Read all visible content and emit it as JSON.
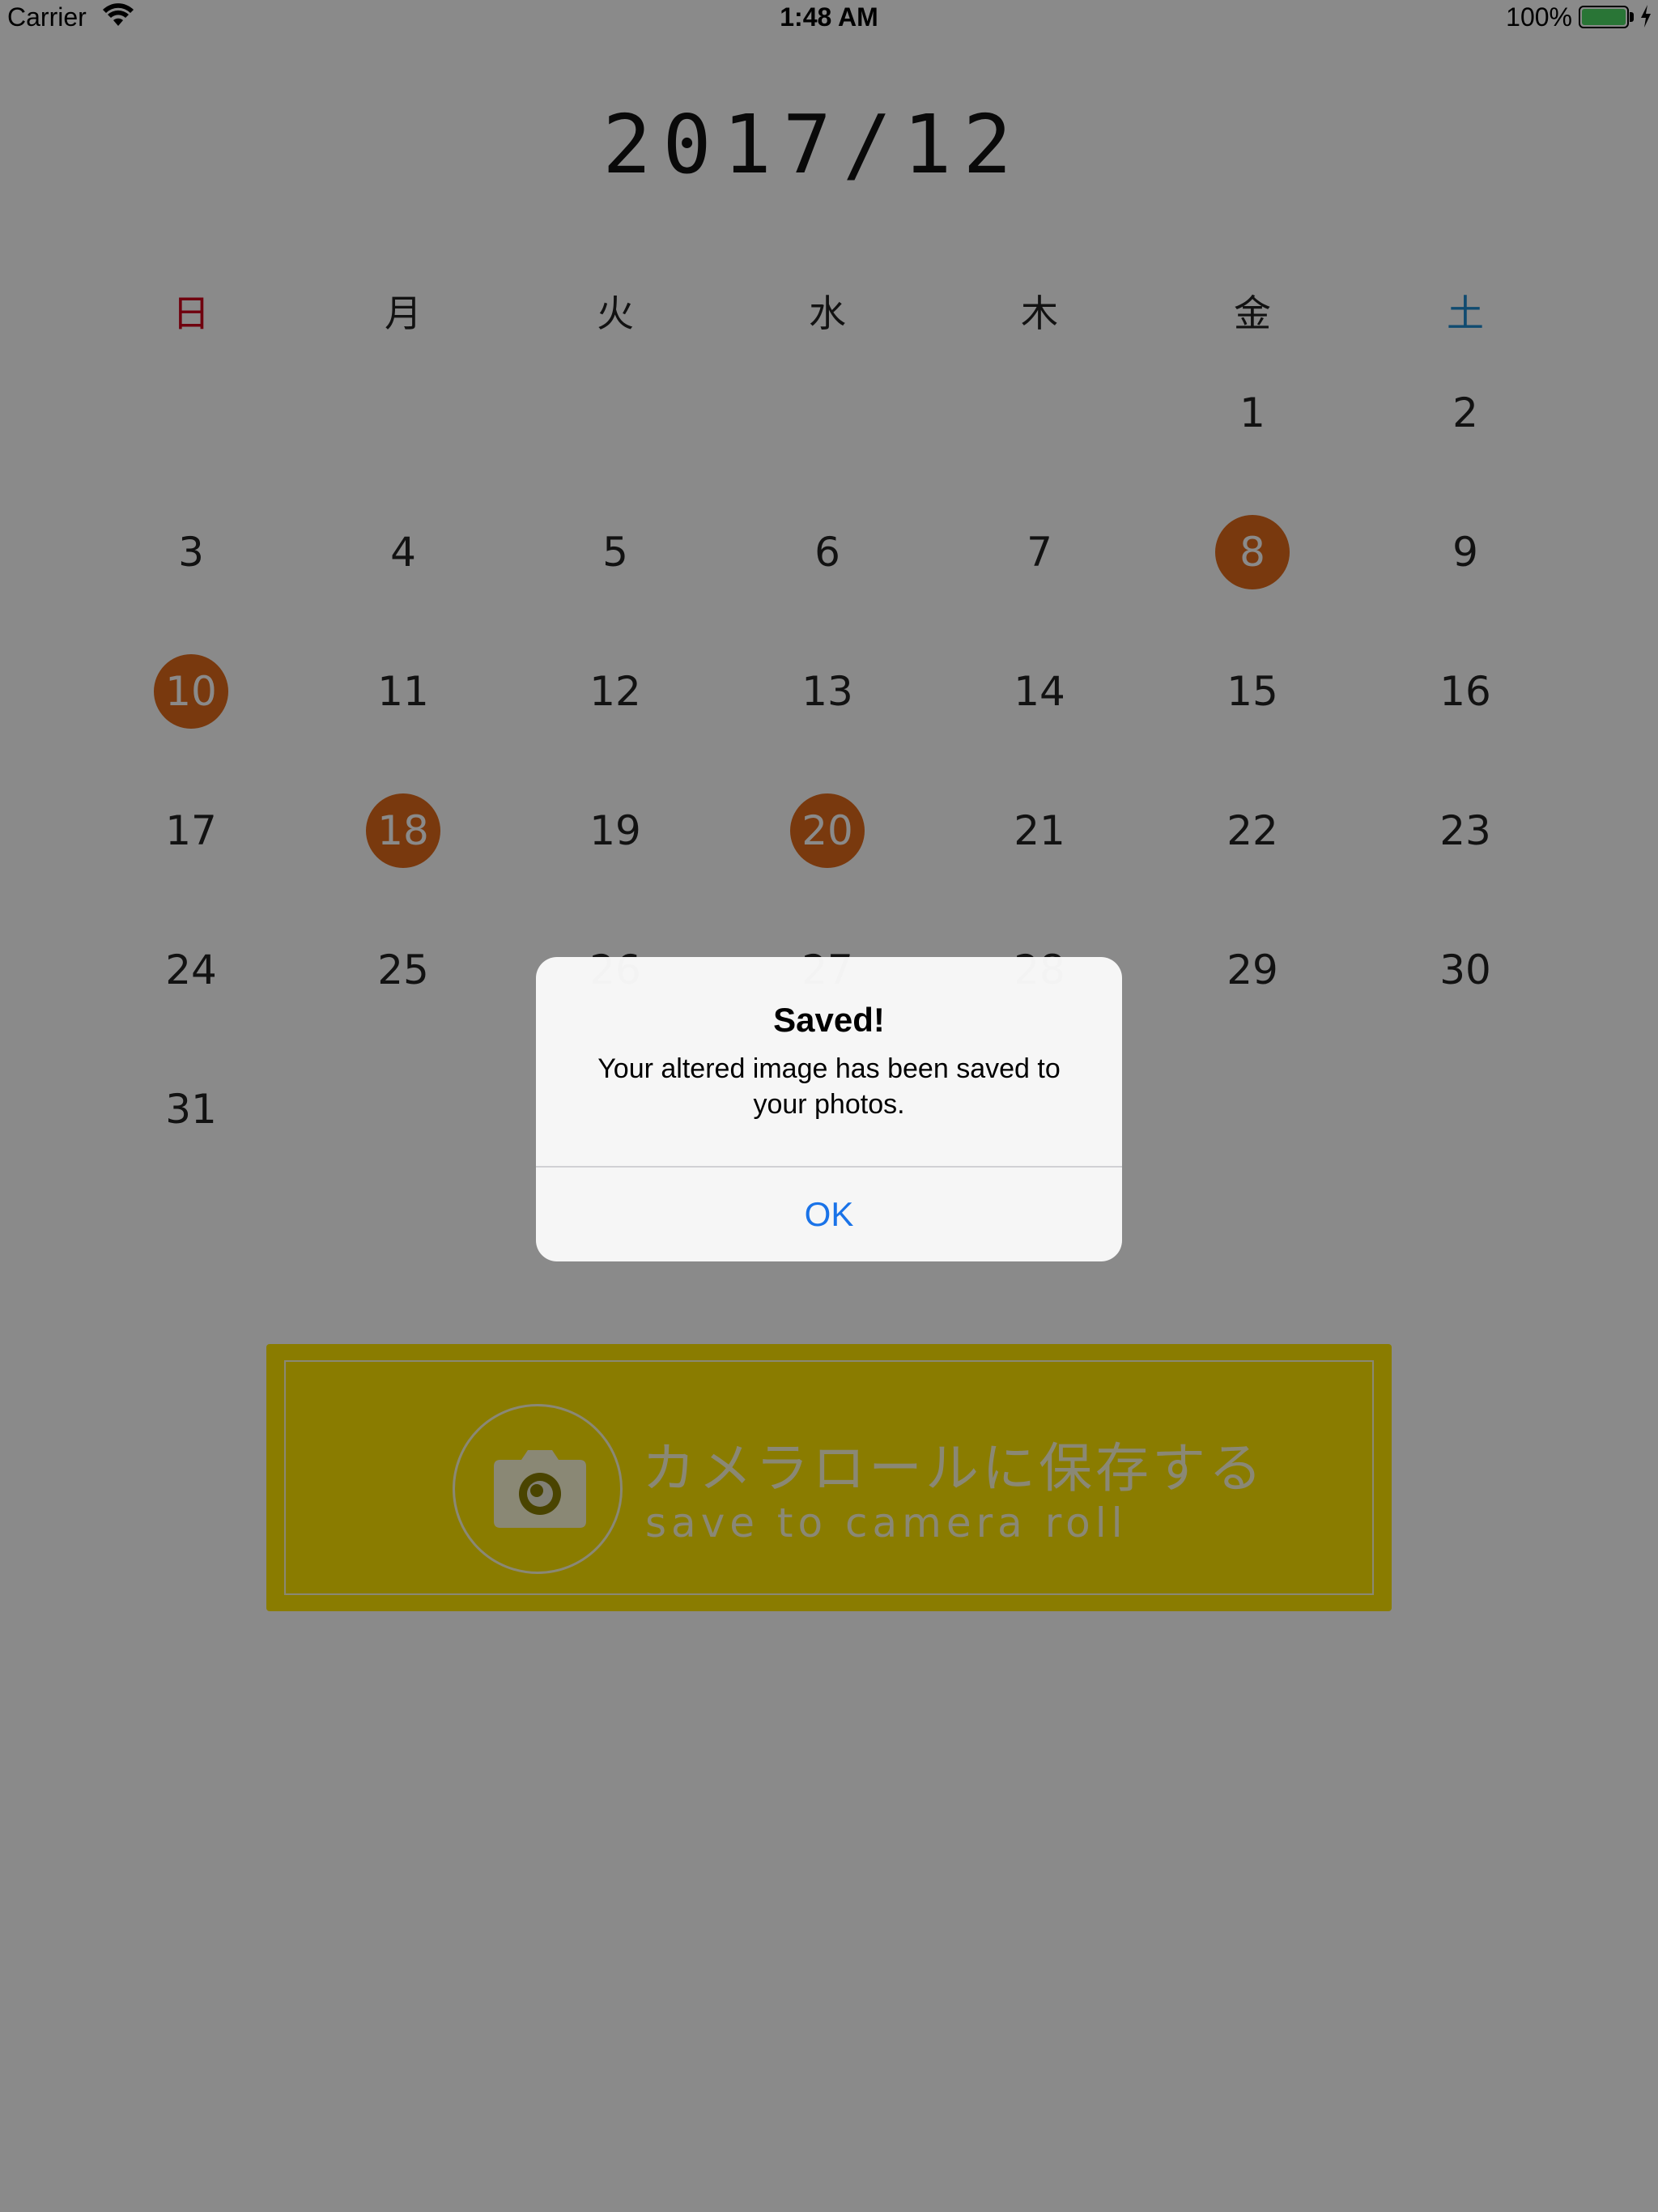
{
  "status_bar": {
    "carrier": "Carrier",
    "time": "1:48 AM",
    "battery_percent": "100%",
    "battery_level": 1.0,
    "battery_color": "#4cd964",
    "wifi_icon": "wifi-icon",
    "charging_icon": "bolt-icon"
  },
  "calendar": {
    "month_title": "2017/12",
    "weekdays": [
      "日",
      "月",
      "火",
      "水",
      "木",
      "金",
      "土"
    ],
    "weekday_colors": {
      "sunday": "#d0021b",
      "saturday": "#1e8bd0",
      "default": "#222222"
    },
    "days": [
      "1",
      "2",
      "3",
      "4",
      "5",
      "6",
      "7",
      "8",
      "9",
      "10",
      "11",
      "12",
      "13",
      "14",
      "15",
      "16",
      "17",
      "18",
      "19",
      "20",
      "21",
      "22",
      "23",
      "24",
      "25",
      "26",
      "27",
      "28",
      "29",
      "30",
      "31"
    ],
    "first_weekday_index": 5,
    "highlighted_days": [
      "8",
      "10",
      "18",
      "20"
    ],
    "highlight_color": "#e06a1a"
  },
  "save_button": {
    "label_jp": "カメラロールに保存する",
    "label_en": "save to camera roll",
    "icon": "camera-icon",
    "color": "#ffe600"
  },
  "alert": {
    "title": "Saved!",
    "message": "Your altered image has been saved to your photos.",
    "ok_label": "OK"
  }
}
